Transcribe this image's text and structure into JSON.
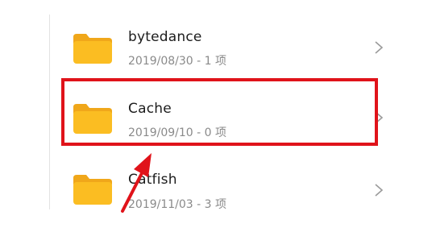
{
  "folders": [
    {
      "name": "bytedance",
      "meta": "2019/08/30 - 1 项",
      "icon": "folder-icon"
    },
    {
      "name": "Cache",
      "meta": "2019/09/10 - 0 项",
      "icon": "folder-icon"
    },
    {
      "name": "Catfish",
      "meta": "2019/11/03 - 3 项",
      "icon": "folder-icon"
    }
  ],
  "colors": {
    "folder": "#fbbd22",
    "folder_tab": "#f0a71a",
    "highlight": "#e0131a",
    "chevron": "#9a9a9a"
  }
}
